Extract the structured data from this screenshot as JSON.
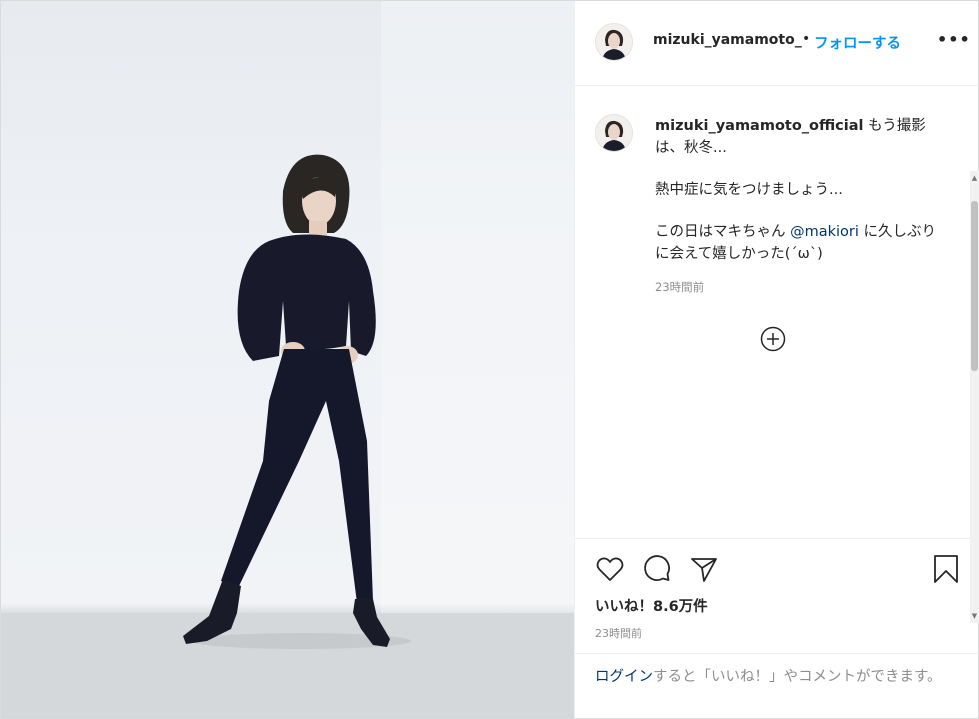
{
  "header": {
    "username": "mizuki_yamamoto_",
    "separator": "•",
    "follow_label": "フォローする",
    "more_label": "•••"
  },
  "post": {
    "author": "mizuki_yamamoto_official",
    "caption_line1": "もう撮影は、秋冬...",
    "caption_line2": "熱中症に気をつけましょう...",
    "caption_pre": "この日はマキちゃん ",
    "caption_mention": "@makiori",
    "caption_post": " に久しぶりに会えて嬉しかった(´ω`)",
    "time": "23時間前"
  },
  "actions": {
    "icons": [
      "heart-icon",
      "comment-icon",
      "share-icon",
      "bookmark-icon"
    ],
    "likes": "いいね！8.6万件",
    "time": "23時間前"
  },
  "footer": {
    "login_link": "ログイン",
    "login_text": "すると「いいね！」やコメントができます。"
  },
  "colors": {
    "accent": "#0095f6",
    "link": "#00376b",
    "muted": "#8e8e8e",
    "text": "#262626"
  }
}
